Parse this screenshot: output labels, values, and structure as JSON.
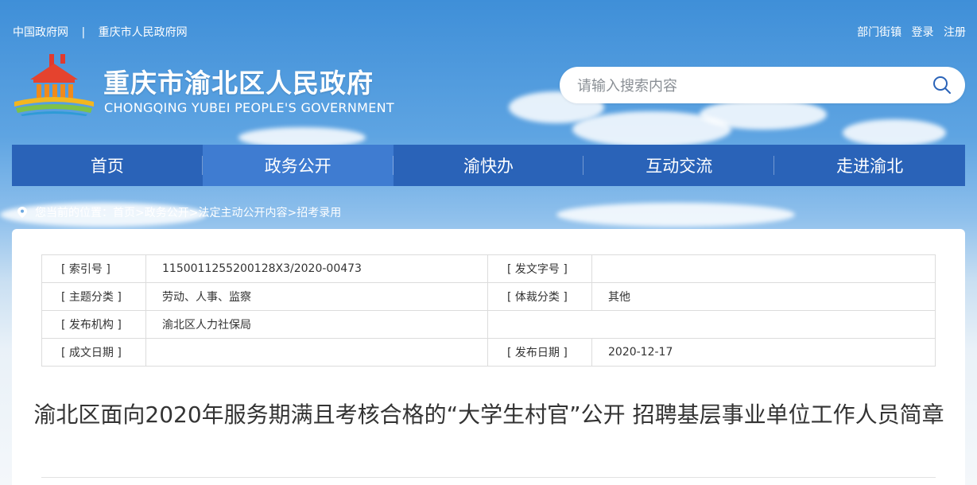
{
  "top_links": {
    "gov_china": "中国政府网",
    "separator": "|",
    "gov_chongqing": "重庆市人民政府网"
  },
  "user_links": {
    "dept": "部门街镇",
    "login": "登录",
    "register": "注册"
  },
  "site": {
    "title": "重庆市渝北区人民政府",
    "subtitle": "CHONGQING YUBEI PEOPLE'S GOVERNMENT"
  },
  "search": {
    "placeholder": "请输入搜索内容",
    "icon": "search-icon"
  },
  "nav": {
    "items": [
      {
        "label": "首页"
      },
      {
        "label": "政务公开"
      },
      {
        "label": "渝快办"
      },
      {
        "label": "互动交流"
      },
      {
        "label": "走进渝北"
      }
    ],
    "active_index": 1
  },
  "breadcrumb": {
    "prefix": "您当前的位置：",
    "items": [
      "首页",
      ">政务公开",
      ">法定主动公开内容",
      ">招考录用"
    ]
  },
  "meta_table": {
    "rows": [
      {
        "l1": "[ 索引号 ]",
        "v1": "1150011255200128X3/2020-00473",
        "l2": "[ 发文字号 ]",
        "v2": ""
      },
      {
        "l1": "[ 主题分类 ]",
        "v1": "劳动、人事、监察",
        "l2": "[ 体裁分类 ]",
        "v2": "其他"
      },
      {
        "l1": "[ 发布机构 ]",
        "v1": "渝北区人力社保局",
        "l2": "",
        "v2": ""
      },
      {
        "l1": "[ 成文日期 ]",
        "v1": "",
        "l2": "[ 发布日期 ]",
        "v2": "2020-12-17"
      }
    ]
  },
  "article": {
    "title": "渝北区面向2020年服务期满且考核合格的“大学生村官”公开 招聘基层事业单位工作人员简章"
  },
  "colors": {
    "nav_bg": "#2a63b8",
    "nav_active": "#3f7cd1"
  }
}
